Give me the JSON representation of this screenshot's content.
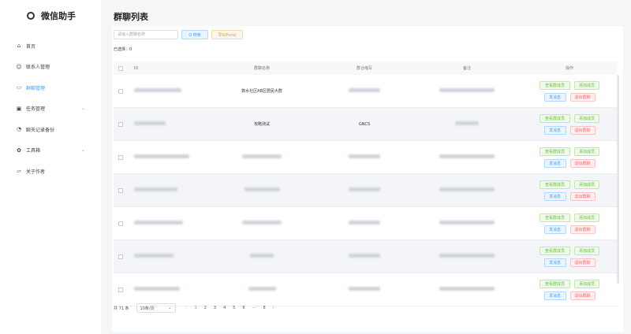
{
  "app": {
    "title": "微信助手"
  },
  "sidebar": {
    "items": [
      {
        "label": "首页",
        "icon": "home-icon",
        "glyph": "⌂"
      },
      {
        "label": "联系人管理",
        "icon": "user-icon",
        "glyph": "☺"
      },
      {
        "label": "群聊管理",
        "icon": "chat-icon",
        "glyph": "▭",
        "active": true
      },
      {
        "label": "任务管理",
        "icon": "clipboard-icon",
        "glyph": "▣",
        "chevron": true
      },
      {
        "label": "聊天记录备份",
        "icon": "headset-icon",
        "glyph": "◔"
      },
      {
        "label": "工具箱",
        "icon": "gear-icon",
        "glyph": "✿",
        "chevron": true
      },
      {
        "label": "关于作者",
        "icon": "info-icon",
        "glyph": "▱"
      }
    ]
  },
  "page": {
    "title": "群聊列表"
  },
  "toolbar": {
    "search_placeholder": "请输入群聊名称",
    "search_label": "Q 搜索",
    "export_label": "导出Excel",
    "selected": "已选择：0"
  },
  "table": {
    "headers": [
      "ID",
      "群聊名称",
      "群合缩写",
      "备注",
      "操作"
    ],
    "rows": [
      {
        "name": "数水社区AB区居民大群",
        "abbr": ""
      },
      {
        "name": "攻略测试",
        "abbr": "GNCS"
      },
      {
        "name": "",
        "abbr": ""
      },
      {
        "name": "",
        "abbr": ""
      },
      {
        "name": "",
        "abbr": ""
      },
      {
        "name": "",
        "abbr": ""
      },
      {
        "name": "",
        "abbr": ""
      }
    ],
    "actions": {
      "view": "查看群成员",
      "add": "添加成员",
      "send": "发消息",
      "quit": "退出群聊"
    }
  },
  "pagination": {
    "total": "共 71 条",
    "page_size": "10条/页",
    "pages": [
      "1",
      "2",
      "3",
      "4",
      "5",
      "6",
      "···",
      "8"
    ],
    "current": "1",
    "prev": "‹",
    "next": "›"
  }
}
